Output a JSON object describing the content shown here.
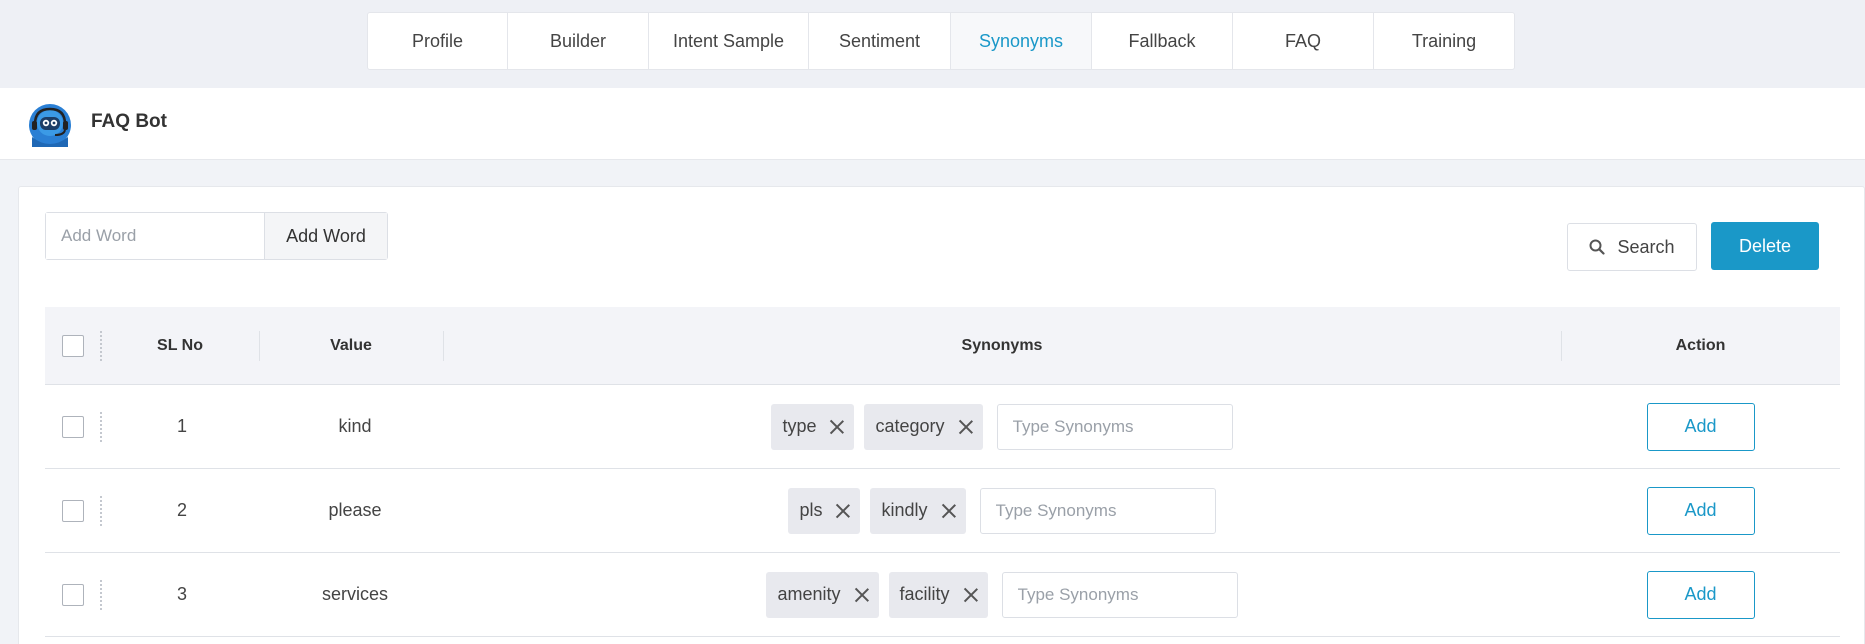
{
  "tabs": [
    {
      "label": "Profile",
      "active": false
    },
    {
      "label": "Builder",
      "active": false
    },
    {
      "label": "Intent Sample",
      "active": false
    },
    {
      "label": "Sentiment",
      "active": false
    },
    {
      "label": "Synonyms",
      "active": true
    },
    {
      "label": "Fallback",
      "active": false
    },
    {
      "label": "FAQ",
      "active": false
    },
    {
      "label": "Training",
      "active": false
    }
  ],
  "bot": {
    "name": "FAQ Bot",
    "avatar_icon": "robot-headset-icon"
  },
  "toolbar": {
    "add_word_placeholder": "Add Word",
    "add_word_button": "Add Word",
    "search_button": "Search",
    "delete_button": "Delete"
  },
  "table": {
    "headers": {
      "sl_no": "SL No",
      "value": "Value",
      "synonyms": "Synonyms",
      "action": "Action"
    },
    "rows": [
      {
        "sl": "1",
        "value": "kind",
        "synonyms": [
          "type",
          "category"
        ],
        "input_placeholder": "Type Synonyms",
        "action": "Add"
      },
      {
        "sl": "2",
        "value": "please",
        "synonyms": [
          "pls",
          "kindly"
        ],
        "input_placeholder": "Type Synonyms",
        "action": "Add"
      },
      {
        "sl": "3",
        "value": "services",
        "synonyms": [
          "amenity",
          "facility"
        ],
        "input_placeholder": "Type Synonyms",
        "action": "Add"
      }
    ]
  },
  "colors": {
    "accent": "#1a98c8",
    "background": "#f1f3f7",
    "tag_bg": "#e8e9ee"
  }
}
